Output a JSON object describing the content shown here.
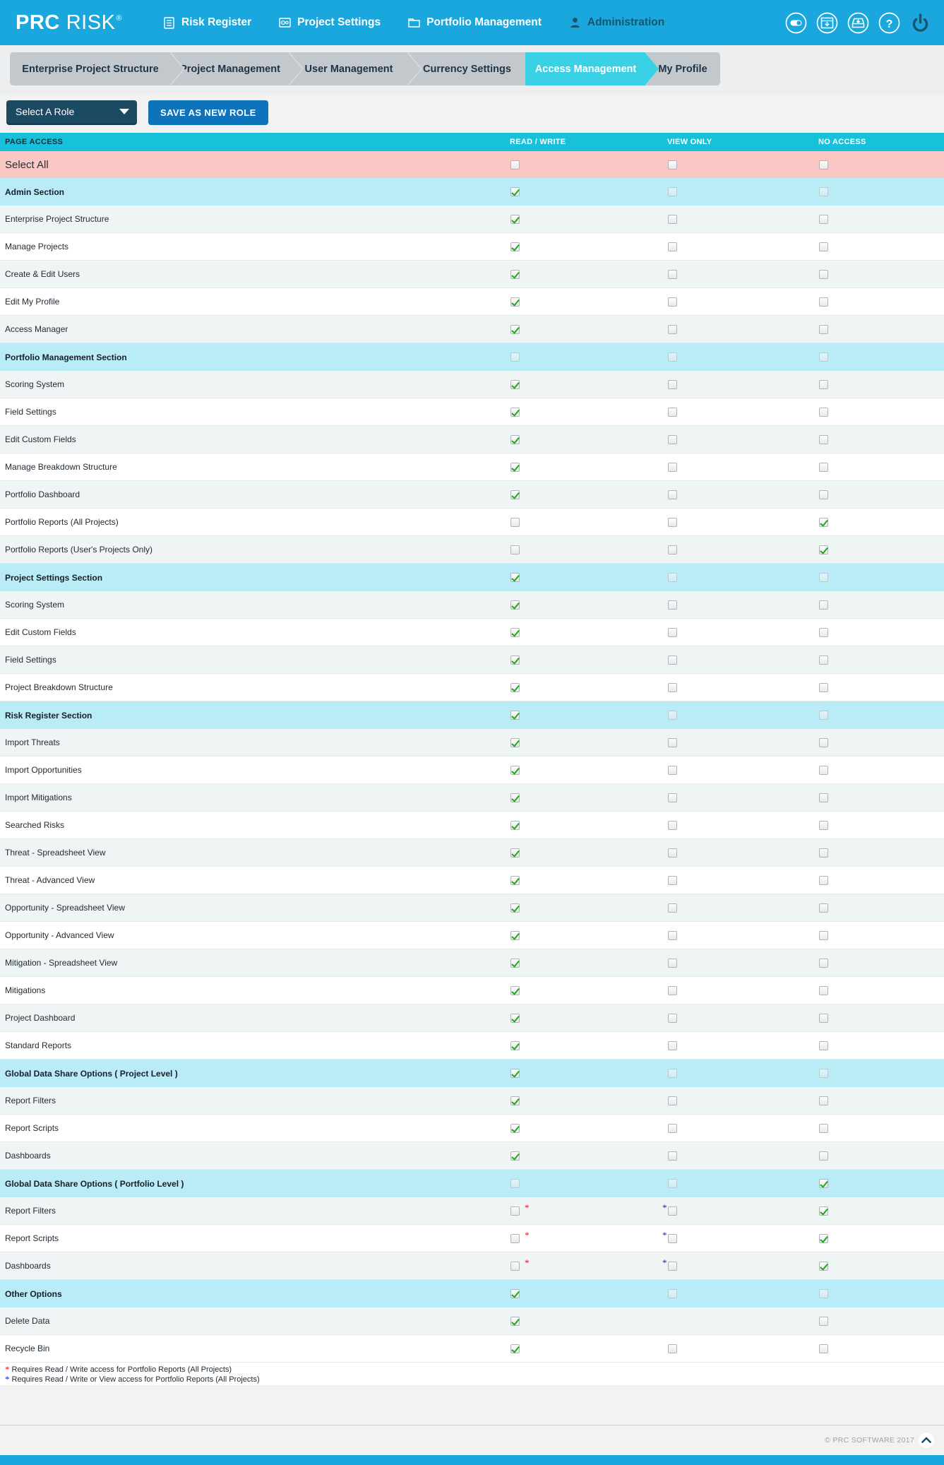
{
  "header": {
    "brand_primary": "PRC",
    "brand_secondary": "RISK",
    "brand_reg": "®",
    "nav": [
      {
        "label": "Risk Register",
        "icon": "list-document-icon",
        "active": false
      },
      {
        "label": "Project Settings",
        "icon": "gear-window-icon",
        "active": false
      },
      {
        "label": "Portfolio Management",
        "icon": "folder-icon",
        "active": false
      },
      {
        "label": "Administration",
        "icon": "user-icon",
        "active": true
      }
    ],
    "right_icons": [
      {
        "name": "toggle-switch-icon"
      },
      {
        "name": "window-download-icon"
      },
      {
        "name": "inbox-download-icon"
      },
      {
        "name": "help-question-icon"
      },
      {
        "name": "power-logout-icon"
      }
    ]
  },
  "breadcrumbs": [
    {
      "label": "Enterprise Project Structure",
      "active": false
    },
    {
      "label": "Project Management",
      "active": false
    },
    {
      "label": "User Management",
      "active": false
    },
    {
      "label": "Currency Settings",
      "active": false
    },
    {
      "label": "Access Management",
      "active": true
    },
    {
      "label": "My Profile",
      "active": false
    }
  ],
  "toolbar": {
    "role_select_value": "Select A Role",
    "save_label": "SAVE AS NEW ROLE"
  },
  "table": {
    "columns": [
      "PAGE ACCESS",
      "READ / WRITE",
      "VIEW ONLY",
      "NO ACCESS"
    ],
    "rows": [
      {
        "label": "Select All",
        "type": "selectall",
        "rw": false,
        "vo": false,
        "na": false
      },
      {
        "label": "Admin Section",
        "type": "section",
        "rw": true,
        "vo": false,
        "na": false
      },
      {
        "label": "Enterprise Project Structure",
        "type": "item",
        "rw": true,
        "vo": false,
        "na": false
      },
      {
        "label": "Manage Projects",
        "type": "item",
        "rw": true,
        "vo": false,
        "na": false
      },
      {
        "label": "Create & Edit Users",
        "type": "item",
        "rw": true,
        "vo": false,
        "na": false
      },
      {
        "label": "Edit My Profile",
        "type": "item",
        "rw": true,
        "vo": false,
        "na": false
      },
      {
        "label": "Access Manager",
        "type": "item",
        "rw": true,
        "vo": false,
        "na": false
      },
      {
        "label": "Portfolio Management Section",
        "type": "section",
        "rw": false,
        "vo": false,
        "na": false
      },
      {
        "label": "Scoring System",
        "type": "item",
        "rw": true,
        "vo": false,
        "na": false
      },
      {
        "label": "Field Settings",
        "type": "item",
        "rw": true,
        "vo": false,
        "na": false
      },
      {
        "label": "Edit Custom Fields",
        "type": "item",
        "rw": true,
        "vo": false,
        "na": false
      },
      {
        "label": "Manage Breakdown Structure",
        "type": "item",
        "rw": true,
        "vo": false,
        "na": false
      },
      {
        "label": "Portfolio Dashboard",
        "type": "item",
        "rw": true,
        "vo": false,
        "na": false
      },
      {
        "label": "Portfolio Reports (All Projects)",
        "type": "item",
        "rw": false,
        "vo": false,
        "na": true
      },
      {
        "label": "Portfolio Reports (User's Projects Only)",
        "type": "item",
        "rw": false,
        "vo": false,
        "na": true
      },
      {
        "label": "Project Settings Section",
        "type": "section",
        "rw": true,
        "vo": false,
        "na": false
      },
      {
        "label": "Scoring System",
        "type": "item",
        "rw": true,
        "vo": false,
        "na": false
      },
      {
        "label": "Edit Custom Fields",
        "type": "item",
        "rw": true,
        "vo": false,
        "na": false
      },
      {
        "label": "Field Settings",
        "type": "item",
        "rw": true,
        "vo": false,
        "na": false
      },
      {
        "label": "Project Breakdown Structure",
        "type": "item",
        "rw": true,
        "vo": false,
        "na": false
      },
      {
        "label": "Risk Register Section",
        "type": "section",
        "rw": true,
        "vo": false,
        "na": false
      },
      {
        "label": "Import Threats",
        "type": "item",
        "rw": true,
        "vo": false,
        "na": false
      },
      {
        "label": "Import Opportunities",
        "type": "item",
        "rw": true,
        "vo": false,
        "na": false
      },
      {
        "label": "Import Mitigations",
        "type": "item",
        "rw": true,
        "vo": false,
        "na": false
      },
      {
        "label": "Searched Risks",
        "type": "item",
        "rw": true,
        "vo": false,
        "na": false
      },
      {
        "label": "Threat - Spreadsheet View",
        "type": "item",
        "rw": true,
        "vo": false,
        "na": false
      },
      {
        "label": "Threat - Advanced View",
        "type": "item",
        "rw": true,
        "vo": false,
        "na": false
      },
      {
        "label": "Opportunity - Spreadsheet View",
        "type": "item",
        "rw": true,
        "vo": false,
        "na": false
      },
      {
        "label": "Opportunity - Advanced View",
        "type": "item",
        "rw": true,
        "vo": false,
        "na": false
      },
      {
        "label": "Mitigation - Spreadsheet View",
        "type": "item",
        "rw": true,
        "vo": false,
        "na": false
      },
      {
        "label": "Mitigations",
        "type": "item",
        "rw": true,
        "vo": false,
        "na": false
      },
      {
        "label": "Project Dashboard",
        "type": "item",
        "rw": true,
        "vo": false,
        "na": false
      },
      {
        "label": "Standard Reports",
        "type": "item",
        "rw": true,
        "vo": false,
        "na": false
      },
      {
        "label": "Global Data Share Options ( Project Level )",
        "type": "section",
        "rw": true,
        "vo": false,
        "na": false
      },
      {
        "label": "Report Filters",
        "type": "item",
        "rw": true,
        "vo": false,
        "na": false
      },
      {
        "label": "Report Scripts",
        "type": "item",
        "rw": true,
        "vo": false,
        "na": false
      },
      {
        "label": "Dashboards",
        "type": "item",
        "rw": true,
        "vo": false,
        "na": false
      },
      {
        "label": "Global Data Share Options ( Portfolio Level )",
        "type": "section",
        "rw": false,
        "vo": false,
        "na": true
      },
      {
        "label": "Report Filters",
        "type": "item",
        "rw": false,
        "vo": false,
        "na": true,
        "rw_star": "red",
        "vo_star": "blue"
      },
      {
        "label": "Report Scripts",
        "type": "item",
        "rw": false,
        "vo": false,
        "na": true,
        "rw_star": "red",
        "vo_star": "blue"
      },
      {
        "label": "Dashboards",
        "type": "item",
        "rw": false,
        "vo": false,
        "na": true,
        "rw_star": "red",
        "vo_star": "blue"
      },
      {
        "label": "Other Options",
        "type": "section",
        "rw": true,
        "vo": false,
        "na": false
      },
      {
        "label": "Delete Data",
        "type": "item",
        "rw": true,
        "vo": null,
        "na": false
      },
      {
        "label": "Recycle Bin",
        "type": "item",
        "rw": true,
        "vo": false,
        "na": false
      }
    ]
  },
  "footnotes": [
    {
      "marker": "*",
      "color": "red",
      "text": "Requires Read / Write access for Portfolio Reports (All Projects)"
    },
    {
      "marker": "*",
      "color": "blue",
      "text": "Requires Read / Write or View access for Portfolio Reports (All Projects)"
    }
  ],
  "footer": {
    "copyright": "© PRC SOFTWARE 2017",
    "to_top_icon": "chevron-up-icon"
  },
  "colors": {
    "brand_blue": "#1aa7dd",
    "header_cyan": "#17c1da",
    "active_tab": "#3ad0e6",
    "section_row": "#b9ecf7",
    "selectall_row": "#f9c7c4",
    "check_green": "#21a821",
    "star_red": "#e8121c",
    "star_blue": "#1119e0"
  }
}
